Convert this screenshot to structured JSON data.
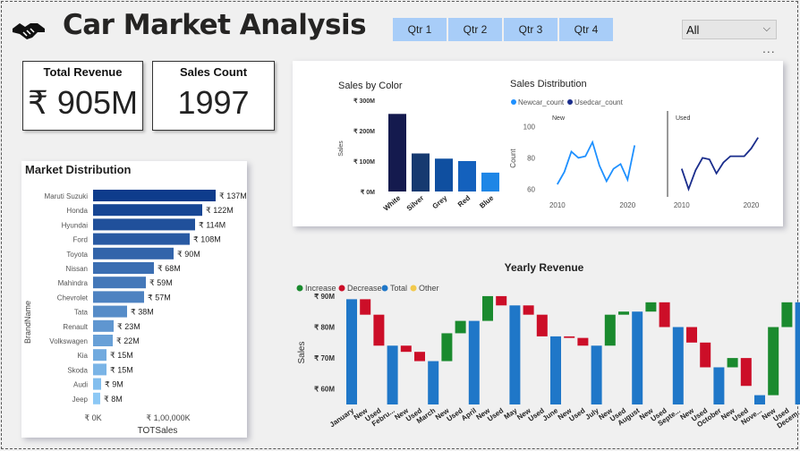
{
  "header": {
    "title": "Car Market Analysis",
    "logo_icon": "handshake-icon"
  },
  "quarters": [
    "Qtr 1",
    "Qtr 2",
    "Qtr 3",
    "Qtr 4"
  ],
  "filter": {
    "selected": "All"
  },
  "more_menu": "...",
  "kpis": {
    "revenue": {
      "label": "Total Revenue",
      "value": "₹ 905M"
    },
    "count": {
      "label": "Sales Count",
      "value": "1997"
    }
  },
  "charts": {
    "market": {
      "title": "Market Distribution",
      "xlabel": "TOTSales",
      "ylabel": "BrandName",
      "xticks": [
        "₹ 0K",
        "₹ 1,00,000K"
      ]
    },
    "color": {
      "title": "Sales by Color",
      "ylabel": "Sales",
      "yticks": [
        "₹ 0M",
        "₹ 100M",
        "₹ 200M",
        "₹ 300M"
      ]
    },
    "dist": {
      "title": "Sales Distribution",
      "legend": [
        "Newcar_count",
        "Usedcar_count"
      ],
      "ylabel": "Count",
      "yticks": [
        "60",
        "80",
        "100"
      ],
      "xticks": [
        "2010",
        "2020"
      ],
      "panels": [
        "New",
        "Used"
      ]
    },
    "yearly": {
      "title": "Yearly Revenue",
      "legend": [
        "Increase",
        "Decrease",
        "Total",
        "Other"
      ],
      "ylabel": "Sales",
      "yticks": [
        "₹ 60M",
        "₹ 70M",
        "₹ 80M",
        "₹ 90M"
      ]
    }
  },
  "colors": {
    "increase": "#1a8a2e",
    "decrease": "#cc0e28",
    "total": "#1f77c8",
    "other": "#f2c94c"
  },
  "chart_data": [
    {
      "type": "bar",
      "orientation": "horizontal",
      "title": "Market Distribution",
      "xlabel": "TOTSales",
      "ylabel": "BrandName",
      "categories": [
        "Maruti Suzuki",
        "Honda",
        "Hyundai",
        "Ford",
        "Toyota",
        "Nissan",
        "Mahindra",
        "Chevrolet",
        "Tata",
        "Renault",
        "Volkswagen",
        "Kia",
        "Skoda",
        "Audi",
        "Jeep"
      ],
      "values": [
        137,
        122,
        114,
        108,
        90,
        68,
        59,
        57,
        38,
        23,
        22,
        15,
        15,
        9,
        8
      ],
      "labels": [
        "₹ 137M",
        "₹ 122M",
        "₹ 114M",
        "₹ 108M",
        "₹ 90M",
        "₹ 68M",
        "₹ 59M",
        "₹ 57M",
        "₹ 38M",
        "₹ 23M",
        "₹ 22M",
        "₹ 15M",
        "₹ 15M",
        "₹ 9M",
        "₹ 8M"
      ],
      "unit": "₹ M"
    },
    {
      "type": "bar",
      "title": "Sales by Color",
      "ylabel": "Sales",
      "categories": [
        "White",
        "Silver",
        "Grey",
        "Red",
        "Blue"
      ],
      "values": [
        255,
        125,
        108,
        100,
        62
      ],
      "ylim": [
        0,
        300
      ],
      "colors": [
        "#141a4e",
        "#163a70",
        "#0f4fa0",
        "#1461bd",
        "#1e86e6"
      ]
    },
    {
      "type": "line",
      "title": "Sales Distribution",
      "ylabel": "Count",
      "ylim": [
        55,
        110
      ],
      "xlim": [
        2009,
        2022
      ],
      "series": [
        {
          "name": "Newcar_count",
          "panel": "New",
          "color": "#1e90ff",
          "x": [
            2010,
            2011,
            2012,
            2013,
            2014,
            2015,
            2016,
            2017,
            2018,
            2019,
            2020,
            2021
          ],
          "y": [
            63,
            71,
            84,
            80,
            81,
            90,
            75,
            65,
            73,
            76,
            66,
            88
          ]
        },
        {
          "name": "Usedcar_count",
          "panel": "Used",
          "color": "#1a2d8c",
          "x": [
            2010,
            2011,
            2012,
            2013,
            2014,
            2015,
            2016,
            2017,
            2018,
            2019,
            2020,
            2021
          ],
          "y": [
            73,
            60,
            72,
            80,
            79,
            70,
            77,
            81,
            81,
            81,
            86,
            93
          ]
        }
      ]
    },
    {
      "type": "waterfall",
      "title": "Yearly Revenue",
      "ylabel": "Sales",
      "ylim": [
        55,
        92
      ],
      "x": [
        "January",
        "New",
        "Used",
        "Febru...",
        "New",
        "Used",
        "March",
        "New",
        "Used",
        "April",
        "New",
        "Used",
        "May",
        "New",
        "Used",
        "June",
        "New",
        "Used",
        "July",
        "New",
        "Used",
        "August",
        "New",
        "Used",
        "Septe...",
        "New",
        "Used",
        "October",
        "New",
        "Used",
        "Nove...",
        "New",
        "Used",
        "Decem..."
      ],
      "steps": [
        {
          "kind": "total",
          "from": 55,
          "to": 89
        },
        {
          "kind": "decrease",
          "from": 89,
          "to": 84
        },
        {
          "kind": "decrease",
          "from": 84,
          "to": 74
        },
        {
          "kind": "total",
          "from": 55,
          "to": 74
        },
        {
          "kind": "decrease",
          "from": 74,
          "to": 72
        },
        {
          "kind": "decrease",
          "from": 72,
          "to": 69
        },
        {
          "kind": "total",
          "from": 55,
          "to": 69
        },
        {
          "kind": "increase",
          "from": 69,
          "to": 78
        },
        {
          "kind": "increase",
          "from": 78,
          "to": 82
        },
        {
          "kind": "total",
          "from": 55,
          "to": 82
        },
        {
          "kind": "increase",
          "from": 82,
          "to": 90
        },
        {
          "kind": "decrease",
          "from": 90,
          "to": 87
        },
        {
          "kind": "total",
          "from": 55,
          "to": 87
        },
        {
          "kind": "decrease",
          "from": 87,
          "to": 84
        },
        {
          "kind": "decrease",
          "from": 84,
          "to": 77
        },
        {
          "kind": "total",
          "from": 55,
          "to": 77
        },
        {
          "kind": "decrease",
          "from": 77,
          "to": 76.5
        },
        {
          "kind": "decrease",
          "from": 76.5,
          "to": 74
        },
        {
          "kind": "total",
          "from": 55,
          "to": 74
        },
        {
          "kind": "increase",
          "from": 74,
          "to": 84
        },
        {
          "kind": "increase",
          "from": 84,
          "to": 85
        },
        {
          "kind": "total",
          "from": 55,
          "to": 85
        },
        {
          "kind": "increase",
          "from": 85,
          "to": 88
        },
        {
          "kind": "decrease",
          "from": 88,
          "to": 80
        },
        {
          "kind": "total",
          "from": 55,
          "to": 80
        },
        {
          "kind": "decrease",
          "from": 80,
          "to": 75
        },
        {
          "kind": "decrease",
          "from": 75,
          "to": 67
        },
        {
          "kind": "total",
          "from": 55,
          "to": 67
        },
        {
          "kind": "increase",
          "from": 67,
          "to": 70
        },
        {
          "kind": "decrease",
          "from": 70,
          "to": 61
        },
        {
          "kind": "total",
          "from": 55,
          "to": 58
        },
        {
          "kind": "increase",
          "from": 58,
          "to": 80
        },
        {
          "kind": "increase",
          "from": 80,
          "to": 88
        },
        {
          "kind": "total",
          "from": 55,
          "to": 88
        }
      ]
    }
  ]
}
